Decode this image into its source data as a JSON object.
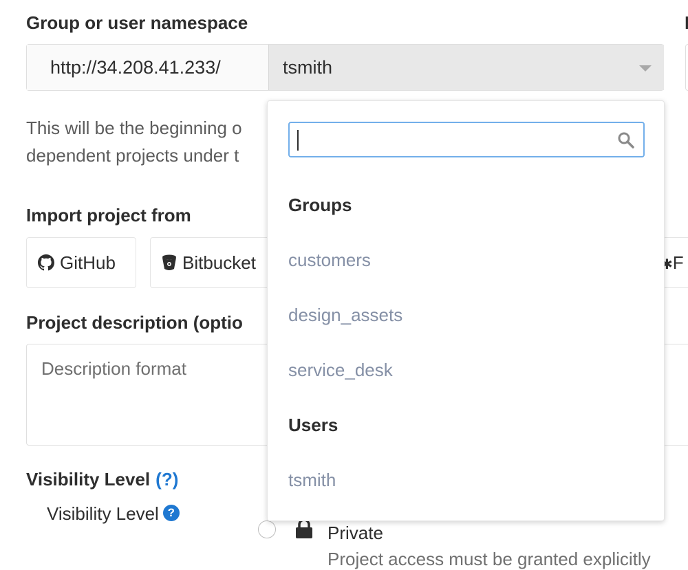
{
  "namespace": {
    "label": "Group or user namespace",
    "url_prefix": "http://34.208.41.233/",
    "selected": "tsmith",
    "help_line1": "This will be the beginning o",
    "help_line2": "dependent projects under t"
  },
  "import": {
    "label": "Import project from",
    "buttons": [
      {
        "label": "GitHub",
        "icon": "github-icon"
      },
      {
        "label": "Bitbucket",
        "icon": "bitbucket-icon"
      },
      {
        "label": "F",
        "icon": "gear-icon"
      }
    ]
  },
  "description": {
    "label": "Project description (optio",
    "placeholder": "Description format"
  },
  "visibility": {
    "label": "Visibility Level",
    "help_link": "(?)",
    "sub_label": "Visibility Level",
    "option_private": "Private",
    "option_private_desc": "Project access must be granted explicitly"
  },
  "dropdown": {
    "search_value": "",
    "groups_header": "Groups",
    "groups": [
      "customers",
      "design_assets",
      "service_desk"
    ],
    "users_header": "Users",
    "users": [
      "tsmith"
    ]
  },
  "colors": {
    "link_blue": "#1f78d1",
    "item_gray": "#8590a6",
    "search_focus": "#73afea"
  }
}
